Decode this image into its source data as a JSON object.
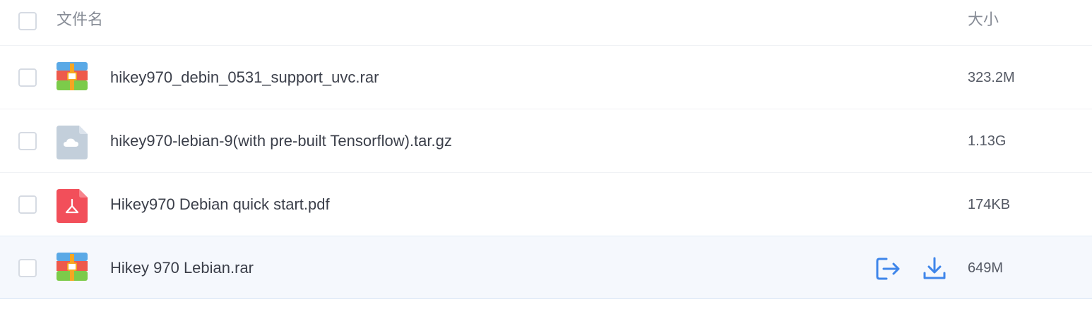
{
  "header": {
    "name_label": "文件名",
    "size_label": "大小"
  },
  "files": [
    {
      "name": "hikey970_debin_0531_support_uvc.rar",
      "size": "323.2M",
      "icon": "rar-archive-icon"
    },
    {
      "name": "hikey970-lebian-9(with pre-built Tensorflow).tar.gz",
      "size": "1.13G",
      "icon": "cloud-file-icon"
    },
    {
      "name": "Hikey970 Debian quick start.pdf",
      "size": "174KB",
      "icon": "pdf-file-icon"
    },
    {
      "name": "Hikey 970 Lebian.rar",
      "size": "649M",
      "icon": "rar-archive-icon",
      "hovered": true
    }
  ],
  "row_actions": {
    "move_icon": "move-to-icon",
    "download_icon": "download-icon"
  },
  "colors": {
    "accent": "#3f86ea",
    "rar_blue": "#5aa9e6",
    "rar_red": "#ee5a4c",
    "rar_green": "#7ccb4a",
    "rar_orange": "#f5a623",
    "cloud_file": "#c3cfdb",
    "pdf_red": "#f24f5a"
  }
}
